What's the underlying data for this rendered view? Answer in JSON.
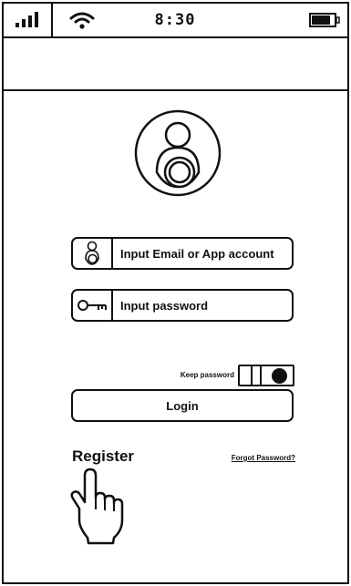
{
  "status_bar": {
    "time": "8:30",
    "signal_icon": "signal-bars-icon",
    "wifi_icon": "wifi-icon",
    "battery_icon": "battery-icon"
  },
  "login_form": {
    "avatar_icon": "user-avatar-icon",
    "account_field": {
      "placeholder": "Input Email or App account",
      "icon": "user-icon"
    },
    "password_field": {
      "placeholder": "Input password",
      "icon": "key-icon"
    },
    "keep_password": {
      "label": "Keep password",
      "enabled": true
    },
    "login_label": "Login",
    "register_label": "Register",
    "forgot_label": "Forgot Password?"
  },
  "annotation": {
    "pointer_icon": "hand-pointer-icon"
  },
  "colors": {
    "ink": "#111111",
    "background": "#ffffff"
  }
}
